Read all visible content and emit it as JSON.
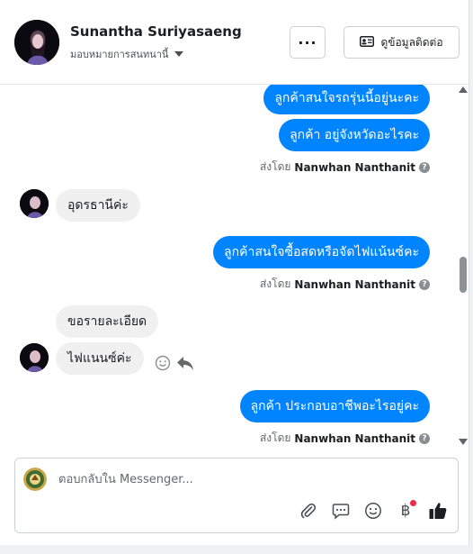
{
  "header": {
    "name": "Sunantha Suriyasaeng",
    "assign_label": "มอบหมายการสนทนานี้",
    "more_label": "···",
    "contact_info_label": "ดูข้อมูลติดต่อ"
  },
  "messages": {
    "out_1": "ลูกค้าสนใจรถรุ่นนี้อยู่นะคะ",
    "out_2": "ลูกค้า  อยู่จังหวัดอะไรคะ",
    "in_1": "อุดรธานีค่ะ",
    "out_3": "ลูกค้าสนใจซื้อสดหรือจัดไฟแน้นซ์คะ",
    "in_2": "ขอรายละเอียด",
    "in_3": "ไฟแนนซ์ค่ะ",
    "out_4": "ลูกค้า ประกอบอาชีพอะไรอยู่คะ",
    "sent_by_prefix": "ส่งโดย",
    "sender": "Nanwhan Nanthanit",
    "help_glyph": "?"
  },
  "composer": {
    "placeholder": "ตอบกลับใน Messenger...",
    "currency_glyph": "฿"
  },
  "colors": {
    "outgoing_bubble": "#0084ff",
    "incoming_bubble": "#f0f0f0",
    "like": "#1c1e21"
  },
  "icons": [
    "more-icon",
    "contact-card-icon",
    "smile-icon",
    "reply-icon",
    "attachment-icon",
    "saved-replies-icon",
    "emoji-icon",
    "payment-icon",
    "like-icon"
  ]
}
